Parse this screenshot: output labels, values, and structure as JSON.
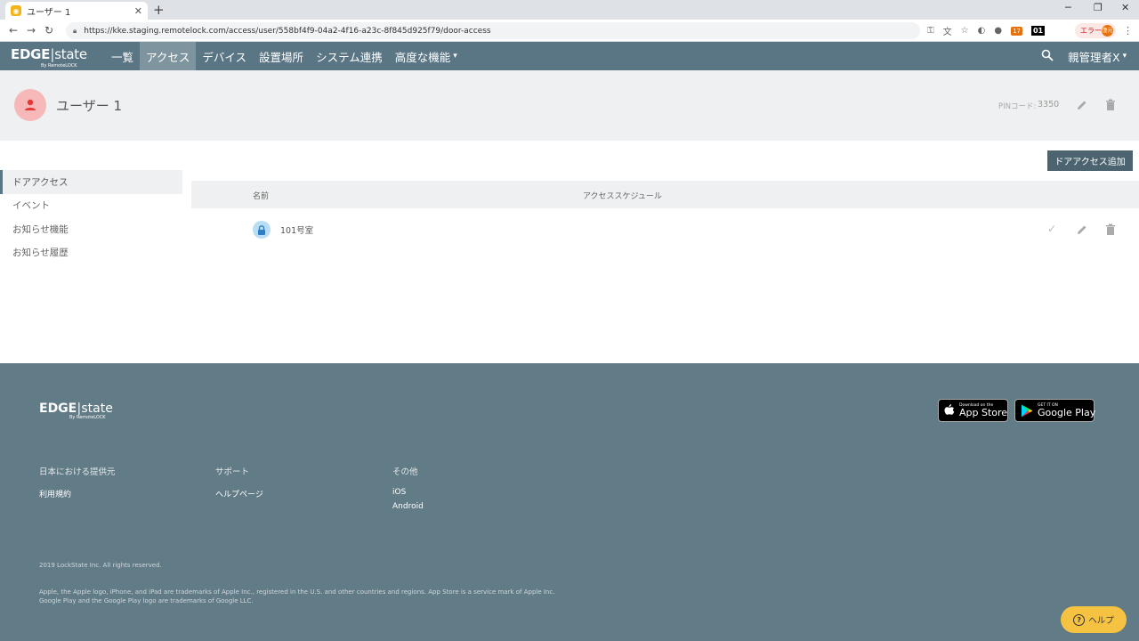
{
  "browser": {
    "tab_title": "ユーザー 1",
    "url": "https://kke.staging.remotelock.com/access/user/558bf4f9-04a2-4f16-a23c-8f845d925f79/door-access",
    "error_label": "エラー",
    "error_badge": "復元",
    "ext_badge_17": "17",
    "ext_badge_01": "01"
  },
  "nav": {
    "logo_main": "EDGE",
    "logo_thin": "state",
    "logo_sub": "By RemoteLOCK",
    "items": [
      "一覧",
      "アクセス",
      "デバイス",
      "設置場所",
      "システム連携",
      "高度な機能"
    ],
    "user": "親管理者X"
  },
  "user": {
    "name": "ユーザー 1",
    "pin_label": "PINコード:",
    "pin_value": "3350"
  },
  "actions": {
    "add_door_access": "ドアアクセス追加"
  },
  "sidebar": {
    "items": [
      "ドアアクセス",
      "イベント",
      "お知らせ機能",
      "お知らせ履歴"
    ]
  },
  "table": {
    "headers": [
      "名前",
      "アクセススケジュール"
    ],
    "rows": [
      {
        "name": "101号室",
        "schedule": ""
      }
    ]
  },
  "footer": {
    "logo_main": "EDGE",
    "logo_thin": "state",
    "logo_sub": "By RemoteLOCK",
    "appstore_small": "Download on the",
    "appstore_big": "App Store",
    "googleplay_small": "GET IT ON",
    "googleplay_big": "Google Play",
    "col1_title": "日本における提供元",
    "col1_links": [
      "利用規約"
    ],
    "col2_title": "サポート",
    "col2_links": [
      "ヘルプページ"
    ],
    "col3_title": "その他",
    "col3_links": [
      "iOS",
      "Android"
    ],
    "copyright": "2019 LockState Inc. All rights reserved.",
    "trademark": "Apple, the Apple logo, iPhone, and iPad are trademarks of Apple Inc., registered in the U.S. and other countries and regions. App Store is a service mark of Apple Inc. Google Play and the Google Play logo are trademarks of Google LLC."
  },
  "help": {
    "label": "ヘルプ"
  },
  "colors": {
    "nav_bg": "#5a7583",
    "nav_active": "#7e959f",
    "footer_bg": "#617b87",
    "button_bg": "#4c6470",
    "avatar_bg": "#f6b8b8",
    "avatar_icon": "#e53935",
    "lock_bg": "#b9ddf5",
    "help_bg": "#f5c242"
  }
}
